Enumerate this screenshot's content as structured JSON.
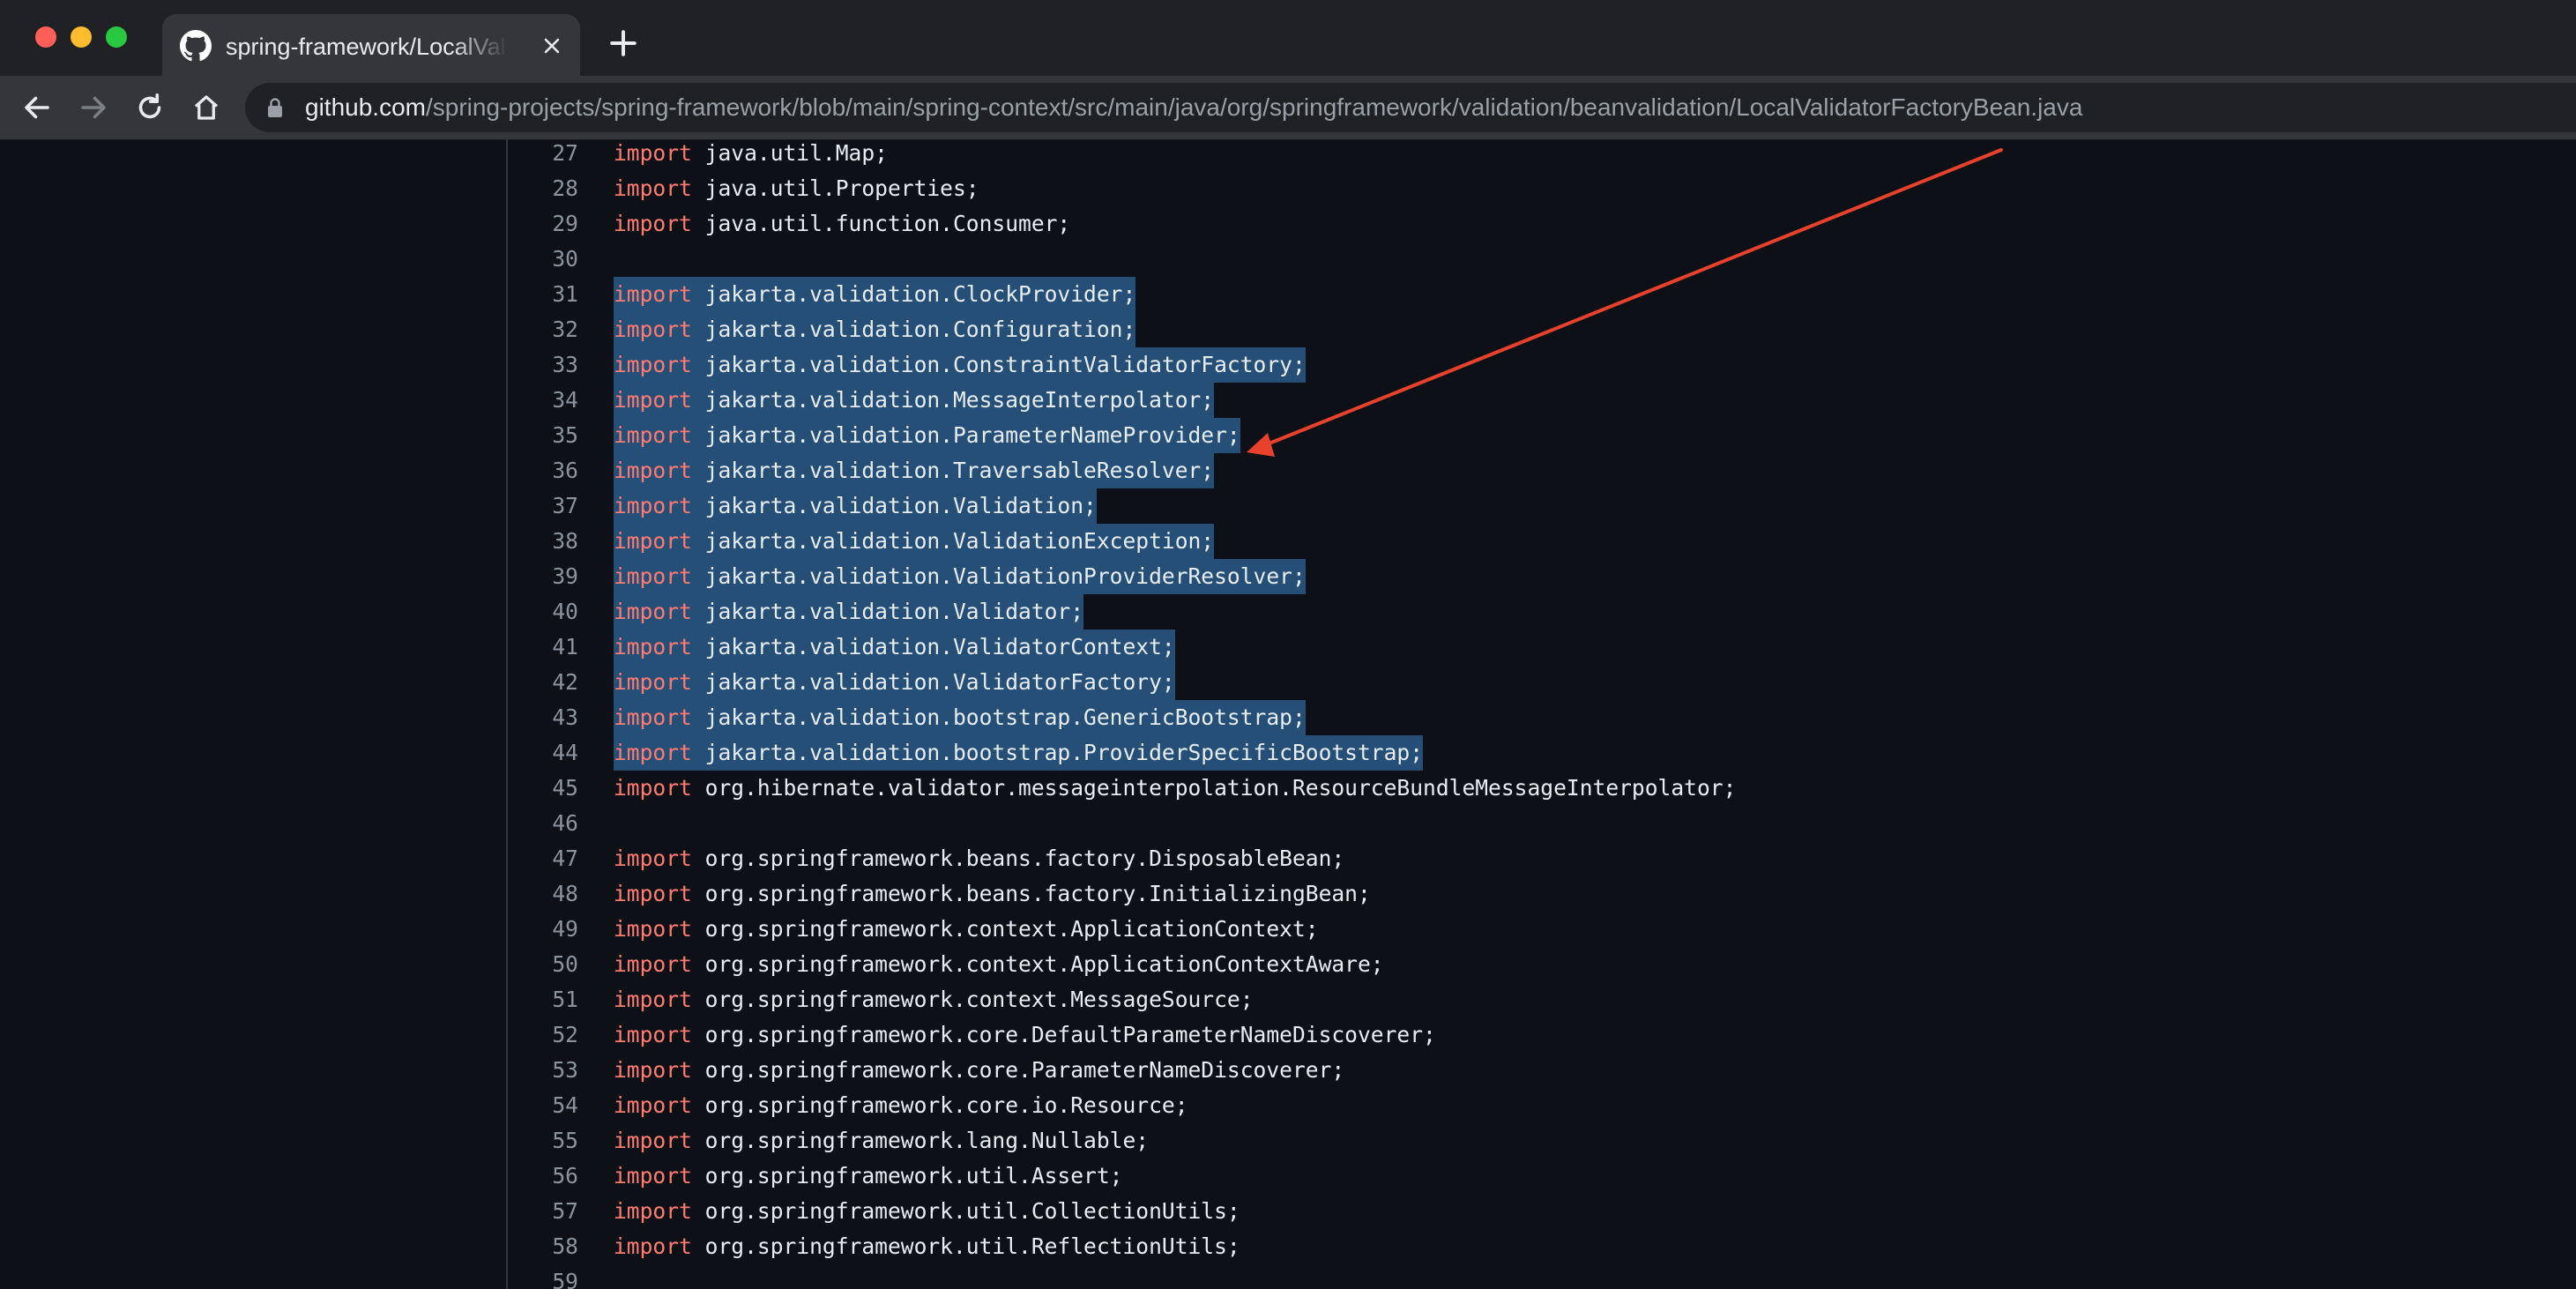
{
  "browser": {
    "tab_title": "spring-framework/LocalValidatorFactoryBean.java",
    "url_host": "github.com",
    "url_path": "/spring-projects/spring-framework/blob/main/spring-context/src/main/java/org/springframework/validation/beanvalidation/LocalValidatorFactoryBean.java"
  },
  "colors": {
    "background": "#0d1117",
    "keyword": "#ff7b72",
    "selection": "#264f78",
    "annotation_arrow": "#e8412c"
  },
  "code": {
    "keyword": "import",
    "selected_lines": "31-44",
    "lines": [
      {
        "n": "27",
        "text": "java.util.Map;",
        "import": true,
        "selected": false
      },
      {
        "n": "28",
        "text": "java.util.Properties;",
        "import": true,
        "selected": false
      },
      {
        "n": "29",
        "text": "java.util.function.Consumer;",
        "import": true,
        "selected": false
      },
      {
        "n": "30",
        "text": "",
        "import": false,
        "selected": false
      },
      {
        "n": "31",
        "text": "jakarta.validation.ClockProvider;",
        "import": true,
        "selected": true
      },
      {
        "n": "32",
        "text": "jakarta.validation.Configuration;",
        "import": true,
        "selected": true
      },
      {
        "n": "33",
        "text": "jakarta.validation.ConstraintValidatorFactory;",
        "import": true,
        "selected": true
      },
      {
        "n": "34",
        "text": "jakarta.validation.MessageInterpolator;",
        "import": true,
        "selected": true
      },
      {
        "n": "35",
        "text": "jakarta.validation.ParameterNameProvider;",
        "import": true,
        "selected": true
      },
      {
        "n": "36",
        "text": "jakarta.validation.TraversableResolver;",
        "import": true,
        "selected": true
      },
      {
        "n": "37",
        "text": "jakarta.validation.Validation;",
        "import": true,
        "selected": true
      },
      {
        "n": "38",
        "text": "jakarta.validation.ValidationException;",
        "import": true,
        "selected": true
      },
      {
        "n": "39",
        "text": "jakarta.validation.ValidationProviderResolver;",
        "import": true,
        "selected": true
      },
      {
        "n": "40",
        "text": "jakarta.validation.Validator;",
        "import": true,
        "selected": true
      },
      {
        "n": "41",
        "text": "jakarta.validation.ValidatorContext;",
        "import": true,
        "selected": true
      },
      {
        "n": "42",
        "text": "jakarta.validation.ValidatorFactory;",
        "import": true,
        "selected": true
      },
      {
        "n": "43",
        "text": "jakarta.validation.bootstrap.GenericBootstrap;",
        "import": true,
        "selected": true
      },
      {
        "n": "44",
        "text": "jakarta.validation.bootstrap.ProviderSpecificBootstrap;",
        "import": true,
        "selected": true
      },
      {
        "n": "45",
        "text": "org.hibernate.validator.messageinterpolation.ResourceBundleMessageInterpolator;",
        "import": true,
        "selected": false
      },
      {
        "n": "46",
        "text": "",
        "import": false,
        "selected": false
      },
      {
        "n": "47",
        "text": "org.springframework.beans.factory.DisposableBean;",
        "import": true,
        "selected": false
      },
      {
        "n": "48",
        "text": "org.springframework.beans.factory.InitializingBean;",
        "import": true,
        "selected": false
      },
      {
        "n": "49",
        "text": "org.springframework.context.ApplicationContext;",
        "import": true,
        "selected": false
      },
      {
        "n": "50",
        "text": "org.springframework.context.ApplicationContextAware;",
        "import": true,
        "selected": false
      },
      {
        "n": "51",
        "text": "org.springframework.context.MessageSource;",
        "import": true,
        "selected": false
      },
      {
        "n": "52",
        "text": "org.springframework.core.DefaultParameterNameDiscoverer;",
        "import": true,
        "selected": false
      },
      {
        "n": "53",
        "text": "org.springframework.core.ParameterNameDiscoverer;",
        "import": true,
        "selected": false
      },
      {
        "n": "54",
        "text": "org.springframework.core.io.Resource;",
        "import": true,
        "selected": false
      },
      {
        "n": "55",
        "text": "org.springframework.lang.Nullable;",
        "import": true,
        "selected": false
      },
      {
        "n": "56",
        "text": "org.springframework.util.Assert;",
        "import": true,
        "selected": false
      },
      {
        "n": "57",
        "text": "org.springframework.util.CollectionUtils;",
        "import": true,
        "selected": false
      },
      {
        "n": "58",
        "text": "org.springframework.util.ReflectionUtils;",
        "import": true,
        "selected": false
      },
      {
        "n": "59",
        "text": "",
        "import": false,
        "selected": false
      }
    ]
  }
}
